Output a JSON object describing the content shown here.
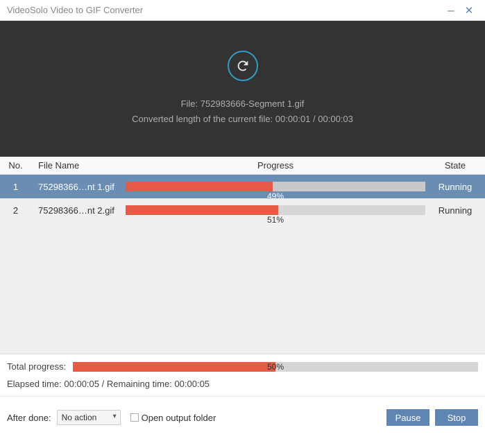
{
  "titlebar": {
    "title": "VideoSolo Video to GIF Converter"
  },
  "preview": {
    "file_label": "File:",
    "file_name": "752983666-Segment 1.gif",
    "length_label": "Converted length of the current file:",
    "length_current": "00:00:01",
    "length_sep": "/",
    "length_total": "00:00:03"
  },
  "table": {
    "headers": {
      "no": "No.",
      "file": "File Name",
      "progress": "Progress",
      "state": "State"
    },
    "rows": [
      {
        "no": "1",
        "file": "75298366…nt 1.gif",
        "progress_pct": 49,
        "progress_label": "49%",
        "state": "Running",
        "selected": true
      },
      {
        "no": "2",
        "file": "75298366…nt 2.gif",
        "progress_pct": 51,
        "progress_label": "51%",
        "state": "Running",
        "selected": false
      }
    ]
  },
  "summary": {
    "total_label": "Total progress:",
    "total_pct": 50,
    "total_label_pct": "50%",
    "elapsed_label": "Elapsed time:",
    "elapsed": "00:00:05",
    "sep": "/",
    "remaining_label": "Remaining time:",
    "remaining": "00:00:05"
  },
  "footer": {
    "after_done_label": "After done:",
    "after_done_value": "No action",
    "open_folder_label": "Open output folder",
    "open_folder_checked": false,
    "pause": "Pause",
    "stop": "Stop"
  }
}
